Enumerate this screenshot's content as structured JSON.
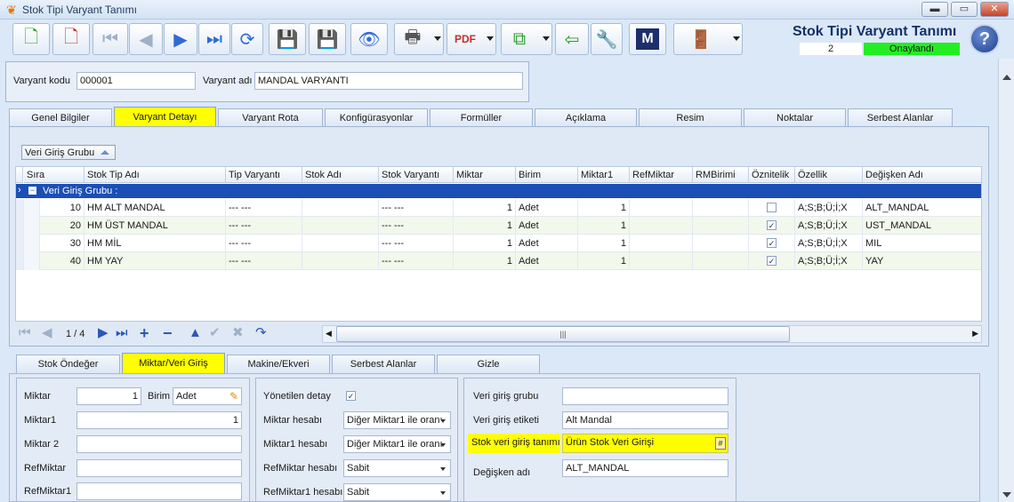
{
  "window": {
    "title": "Stok Tipi Varyant Tanımı",
    "minimize": "▬",
    "maximize": "▭",
    "close": "✕"
  },
  "header": {
    "title": "Stok Tipi Varyant Tanımı",
    "number": "2",
    "status": "Onaylandı",
    "help": "?"
  },
  "toolbar": {
    "m_label": "M"
  },
  "variant": {
    "code_label": "Varyant kodu",
    "code_value": "000001",
    "name_label": "Varyant adı",
    "name_value": "MANDAL VARYANTI"
  },
  "main_tabs": [
    "Genel Bilgiler",
    "Varyant Detayı",
    "Varyant Rota",
    "Konfigürasyonlar",
    "Formüller",
    "Açıklama",
    "Resim",
    "Noktalar",
    "Serbest Alanlar"
  ],
  "grid": {
    "group_by_label": "Veri Giriş Grubu",
    "columns": [
      "Sıra",
      "Stok Tip Adı",
      "Tip Varyantı",
      "Stok Adı",
      "Stok Varyantı",
      "Miktar",
      "Birim",
      "Miktar1",
      "RefMiktar",
      "RMBirimi",
      "Öznitelik",
      "Özellik",
      "Değişken Adı"
    ],
    "group_row": "Veri Giriş Grubu :",
    "rows": [
      {
        "sira": "10",
        "stok_tip_adi": "HM ALT MANDAL",
        "tip_varyanti": "--- ---",
        "stok_adi": "",
        "stok_varyanti": "--- ---",
        "miktar": "1",
        "birim": "Adet",
        "miktar1": "1",
        "refmiktar": "",
        "rmbirimi": "",
        "oznitelik": "",
        "ozellik": "A;S;B;Ü;İ;X",
        "degisken_adi": "ALT_MANDAL"
      },
      {
        "sira": "20",
        "stok_tip_adi": "HM ÜST MANDAL",
        "tip_varyanti": "--- ---",
        "stok_adi": "",
        "stok_varyanti": "--- ---",
        "miktar": "1",
        "birim": "Adet",
        "miktar1": "1",
        "refmiktar": "",
        "rmbirimi": "",
        "oznitelik": "✓",
        "ozellik": "A;S;B;Ü;İ;X",
        "degisken_adi": "UST_MANDAL"
      },
      {
        "sira": "30",
        "stok_tip_adi": "HM MİL",
        "tip_varyanti": "--- ---",
        "stok_adi": "",
        "stok_varyanti": "--- ---",
        "miktar": "1",
        "birim": "Adet",
        "miktar1": "1",
        "refmiktar": "",
        "rmbirimi": "",
        "oznitelik": "✓",
        "ozellik": "A;S;B;Ü;İ;X",
        "degisken_adi": "MIL"
      },
      {
        "sira": "40",
        "stok_tip_adi": "HM YAY",
        "tip_varyanti": "--- ---",
        "stok_adi": "",
        "stok_varyanti": "--- ---",
        "miktar": "1",
        "birim": "Adet",
        "miktar1": "1",
        "refmiktar": "",
        "rmbirimi": "",
        "oznitelik": "✓",
        "ozellik": "A;S;B;Ü;İ;X",
        "degisken_adi": "YAY"
      }
    ],
    "navigator": {
      "position": "1 / 4",
      "scroll_grip": "|||"
    }
  },
  "sub_tabs": [
    "Stok Öndeğer",
    "Miktar/Veri Giriş",
    "Makine/Ekveri",
    "Serbest Alanlar",
    "Gizle"
  ],
  "miktar_panel": {
    "miktar_label": "Miktar",
    "miktar_value": "1",
    "birim_label": "Birim",
    "birim_value": "Adet",
    "miktar1_label": "Miktar1",
    "miktar1_value": "1",
    "miktar2_label": "Miktar 2",
    "miktar2_value": "",
    "refmiktar_label": "RefMiktar",
    "refmiktar_value": "",
    "refmiktar1_label": "RefMiktar1",
    "refmiktar1_value": ""
  },
  "hesap_panel": {
    "yonetilen_label": "Yönetilen detay",
    "yonetilen_check": "✓",
    "miktar_hesabi_label": "Miktar hesabı",
    "miktar_hesabi_value": "Diğer Miktar1 ile oranı",
    "miktar1_hesabi_label": "Miktar1 hesabı",
    "miktar1_hesabi_value": "Diğer Miktar1 ile oranı",
    "refmiktar_hesabi_label": "RefMiktar hesabı",
    "refmiktar_hesabi_value": "Sabit",
    "refmiktar1_hesabi_label": "RefMiktar1 hesabı",
    "refmiktar1_hesabi_value": "Sabit"
  },
  "veri_panel": {
    "grubu_label": "Veri giriş grubu",
    "grubu_value": "",
    "etiketi_label": "Veri giriş etiketi",
    "etiketi_value": "Alt Mandal",
    "stok_veri_label": "Stok veri giriş tanımı",
    "stok_veri_value": "Ürün Stok Veri Girişi",
    "stok_veri_button": "#",
    "degisken_label": "Değişken adı",
    "degisken_value": "ALT_MANDAL"
  }
}
